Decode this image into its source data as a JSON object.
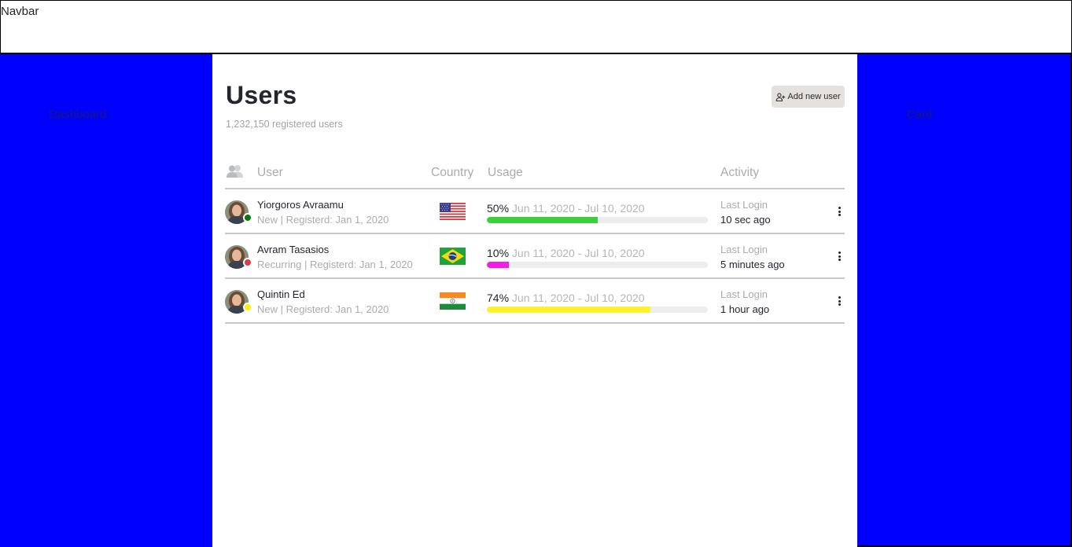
{
  "navbar": {
    "label": "Navbar"
  },
  "left_sidebar": {
    "label": "Dashboard"
  },
  "right_sidebar": {
    "label": "Card"
  },
  "header": {
    "title": "Users",
    "subtitle": "1,232,150 registered users",
    "add_button_label": "Add new user",
    "add_button_icon": "user-plus-icon"
  },
  "table": {
    "columns": {
      "user_icon": "users-icon",
      "user": "User",
      "country": "Country",
      "usage": "Usage",
      "activity": "Activity"
    },
    "rows": [
      {
        "name": "Yiorgoros Avraamu",
        "meta": "New | Registerd: Jan 1, 2020",
        "status_color": "#0a7a0a",
        "country_icon": "flag-us-icon",
        "usage_percent_label": "50%",
        "usage_percent": 50,
        "usage_range": "Jun 11, 2020 - Jul 10, 2020",
        "bar_color": "#3ccf3c",
        "activity_label": "Last Login",
        "activity_value": "10 sec ago"
      },
      {
        "name": "Avram Tasasios",
        "meta": "Recurring | Registerd: Jan 1, 2020",
        "status_color": "#e03a4a",
        "country_icon": "flag-br-icon",
        "usage_percent_label": "10%",
        "usage_percent": 10,
        "usage_range": "Jun 11, 2020 - Jul 10, 2020",
        "bar_color": "#f21ee6",
        "activity_label": "Last Login",
        "activity_value": "5 minutes ago"
      },
      {
        "name": "Quintin Ed",
        "meta": "New | Registerd: Jan 1, 2020",
        "status_color": "#ffee00",
        "country_icon": "flag-in-icon",
        "usage_percent_label": "74%",
        "usage_percent": 74,
        "usage_range": "Jun 11, 2020 - Jul 10, 2020",
        "bar_color": "#fff22a",
        "activity_label": "Last Login",
        "activity_value": "1 hour ago"
      }
    ]
  }
}
